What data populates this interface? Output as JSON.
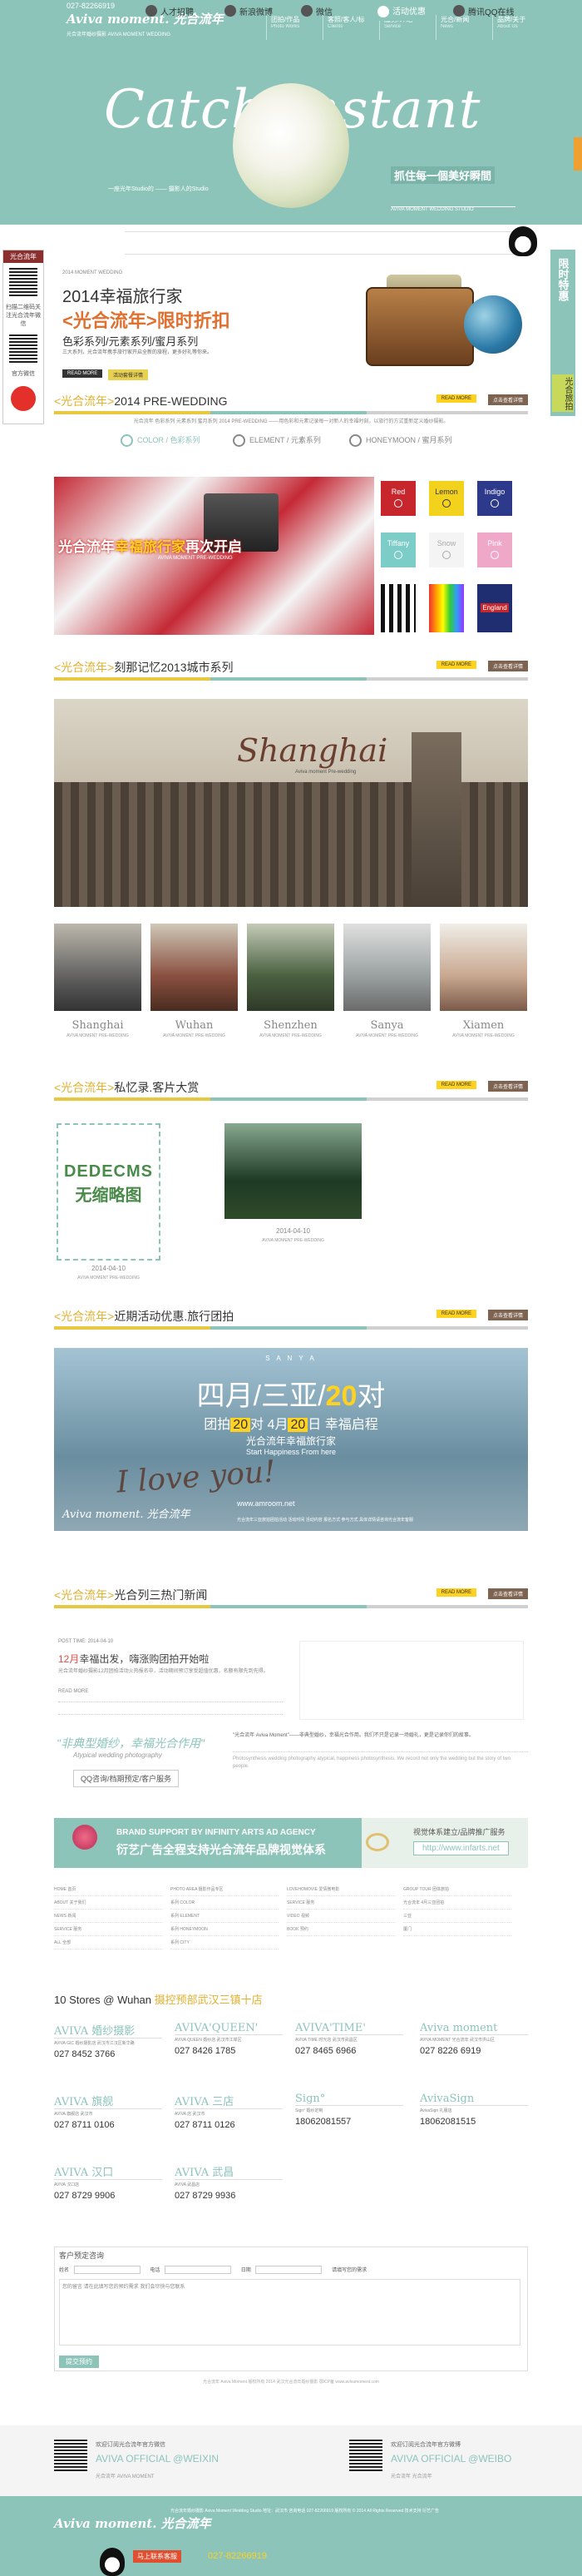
{
  "header": {
    "phone": "027-82266919",
    "logo": "Aviva moment. 光合流年",
    "tagline": "光合流年婚纱摄影 AVIVA MOMENT WEDDING",
    "nav": [
      {
        "cn": "团拍/作品",
        "en": "Photo Works"
      },
      {
        "cn": "客照/客人/标",
        "en": "Clients"
      },
      {
        "cn": "服务/介绍",
        "en": "Service"
      },
      {
        "cn": "光合/新闻",
        "en": "News"
      },
      {
        "cn": "品牌/关于",
        "en": "About Us"
      }
    ]
  },
  "hero": {
    "title": "Catch Instant",
    "sub": "抓住每一個美好瞬間",
    "small": "一座光年Studio的 —— 摄影人的Studio",
    "rline": "AVIVA MOMENT WEDDING STUDIO"
  },
  "menu": {
    "items": [
      "人才招聘",
      "新浪微博",
      "微信",
      "活动优惠",
      "腾讯QQ在线"
    ]
  },
  "left_sidebar": {
    "head": "光合流年",
    "t1": "扫描二维码关注光合流年微信",
    "t2": "官方微信"
  },
  "right_tab": {
    "label": "限时特惠",
    "sub": "光合旅拍"
  },
  "promo": {
    "date": "2014 MOMENT WEDDING",
    "h1": "2014幸福旅行家",
    "h2": "<光合流年>限时折扣",
    "h3": "色彩系列/元素系列/蜜月系列",
    "desc": "三大系列，光合流年携手旅行家开启全新的旅程，更多好礼等你来。",
    "more": "READ MORE",
    "btn": "活动套餐详情"
  },
  "sections": {
    "prewedding": {
      "a": "<光合流年>",
      "b": "2014 PRE-WEDDING"
    },
    "city": {
      "a": "<光合流年>",
      "b": "刻那记忆2013城市系列"
    },
    "guests": {
      "a": "<光合流年>",
      "b": "私忆录.客片大赏"
    },
    "offers": {
      "a": "<光合流年>",
      "b": "近期活动优惠.旅行团拍"
    },
    "news": {
      "a": "<光合流年>",
      "b": "光合列三热门新闻"
    },
    "more": "READ MORE",
    "btn": "点击查看详情"
  },
  "prewedding": {
    "desc": "光合流年 色彩系列 元素系列 蜜月系列 2014 PRE-WEDDING ——用色彩和元素记录每一对新人的幸福时刻，以旅行的方式重新定义婚纱摄影。",
    "tabs": [
      "COLOR / 色彩系列",
      "ELEMENT / 元素系列",
      "HONEYMOON / 蜜月系列"
    ],
    "banner_cap": "光合流年",
    "banner_cap2": "幸福旅行家",
    "banner_cap3": "再次开启",
    "banner_sub": "AVIVA MOMENT PRE-WEDDING",
    "swatches": [
      "Red",
      "Lemon",
      "Indigo",
      "Tiffany",
      "Snow",
      "Pink"
    ],
    "england": "England"
  },
  "city": {
    "title": "Shanghai",
    "sub": "Aviva moment Pre-wedding",
    "thumbs": [
      {
        "n": "Shanghai",
        "s": "AVIVA MOMENT PRE-WEDDING"
      },
      {
        "n": "Wuhan",
        "s": "AVIVA MOMENT PRE-WEDDING"
      },
      {
        "n": "Shenzhen",
        "s": "AVIVA MOMENT PRE-WEDDING"
      },
      {
        "n": "Sanya",
        "s": "AVIVA MOMENT PRE-WEDDING"
      },
      {
        "n": "Xiamen",
        "s": "AVIVA MOMENT PRE-WEDDING"
      }
    ]
  },
  "guests": {
    "noimg_a": "DEDECMS",
    "noimg_b": "无缩略图",
    "date1": "2014-04-10",
    "sub1": "AVIVA MOMENT PRE-WEDDING",
    "date2": "2014-04-10",
    "sub2": "AVIVA MOMENT PRE-WEDDING"
  },
  "sanya": {
    "top": "S A N Y A",
    "big_a": "四月/三亚/",
    "big_b": "20",
    "big_c": "对",
    "mid_a": "团拍",
    "mid_b": "20",
    "mid_c": "对 4月",
    "mid_d": "20",
    "mid_e": "日 幸福启程",
    "s1": "光合流年幸福旅行家",
    "s2": "Start Happiness From here",
    "love": "I love you!",
    "logo": "Aviva moment. 光合流年",
    "url": "www.amroom.net",
    "fine": "光合流年三亚旅拍团拍活动 活动时间 活动内容 报名方式 参与方式 具体详情请咨询光合流年客服"
  },
  "news": {
    "date": "POST TIME: 2014-04-10",
    "title_a": "12月",
    "title_b": "幸福出发，嗨涨购团拍开始啦",
    "body": "光合流年婚纱摄影12月团拍活动火热报名中，活动期间预订享受超值优惠，名额有限先到先得。",
    "post": "READ MORE"
  },
  "quote": {
    "title": "\"非典型婚纱，幸福光合作用\"",
    "sub": "Atypical wedding photography",
    "btn": "QQ咨询/档期预定/客户服务",
    "text": "\"光合流年 Aviva Moment\"——非典型婚纱，幸福光合作用。我们不只是记录一场婚礼，更是记录你们的故事。",
    "text2": "Photosynthesis wedding photography atypical, happiness photosynthesis. We record not only the wedding but the story of two people."
  },
  "ad": {
    "t1": "BRAND SUPPORT BY INFINITY ARTS AD AGENCY",
    "t2": "衍艺广告全程支持光合流年品牌视觉体系",
    "rt": "视觉体系建立/品牌推广服务",
    "url": "http://www.infarts.net"
  },
  "links": {
    "cols": [
      [
        "HOME 首页",
        "ABOUT 关于我们",
        "NEWS 新闻",
        "SERVICE 服务",
        "ALL 全部",
        "GALLERY 作品"
      ],
      [
        "PHOTO AREA 摄影作品专区",
        "系列 COLOR",
        "系列 ELEMENT",
        "系列 HONEYMOON",
        "系列 CITY"
      ],
      [
        "LOVEHOMOVIE 爱情微电影",
        "SERVICE 服务",
        "VIDEO 视频",
        "BOOK 预约"
      ],
      [
        "GROUP TOUR 团体旅拍",
        "光合流年 4月三亚团拍",
        "三亚",
        "厦门"
      ]
    ]
  },
  "stores": {
    "title_a": "10 Stores @ Wuhan",
    "title_b": "摄控预部武汉三镇十店",
    "list": [
      {
        "n": "AVIVA 婚纱摄影",
        "a": "AVIVA GIC 婚纱摄影店 武汉市江汉区新华路",
        "p": "027 8452 3766"
      },
      {
        "n": "AVIVA'QUEEN'",
        "a": "AVIVA QUEEN 婚纱店 武汉市江岸区",
        "p": "027 8426 1785"
      },
      {
        "n": "AVIVA'TIME'",
        "a": "AVIVA TIME 时光店 武汉市武昌区",
        "p": "027 8465 6966"
      },
      {
        "n": "Aviva moment",
        "a": "AVIVA MOMENT 光合流年 武汉市洪山区",
        "p": "027 8226 6919"
      },
      {
        "n": "AVIVA 旗舰",
        "a": "AVIVA 旗舰店 武汉市",
        "p": "027 8711 0106"
      },
      {
        "n": "Sign°",
        "a": "Sign° 婚纱定制",
        "p": "18062081557"
      },
      {
        "n": "AvivaSign",
        "a": "AvivaSign 礼服店",
        "p": "18062081515"
      },
      {
        "n": "AVIVA 三店",
        "a": "AVIVA 店 武汉市",
        "p": "027 8711 0126"
      },
      {
        "n": "AVIVA 汉口",
        "a": "AVIVA 汉口店",
        "p": "027 8729 9906"
      },
      {
        "n": "AVIVA 武昌",
        "a": "AVIVA 武昌店",
        "p": "027 8729 9936"
      }
    ]
  },
  "form": {
    "title": "客户预定咨询",
    "name": "姓名",
    "phone": "电话",
    "date": "日期",
    "note": "请填写您的需求",
    "ta": "您的留言 请在此填写您的预约需求 我们会尽快与您联系",
    "submit": "提交预约"
  },
  "fine2": "光合流年 Aviva Moment 版权所有 2014 武汉光合流年婚纱摄影 鄂ICP备 www.avivamoment.com",
  "social": {
    "l_t": "欢迎订阅光合流年官方微信",
    "l_b": "AVIVA OFFICIAL @WEIXIN",
    "l_f": "光合流年 AVIVA MOMENT",
    "r_t": "欢迎订阅光合流年官方微博",
    "r_b": "AVIVA OFFICIAL @WEIBO",
    "r_f": "光合流年 光合流年"
  },
  "footer": {
    "logo": "Aviva moment. 光合流年",
    "text": "光合流年婚纱摄影 Aviva Moment Wedding Studio 地址：武汉市 咨询电话 027-82266919 版权所有 © 2014 All Rights Reserved 技术支持 衍艺广告",
    "qq": "马上联系客服",
    "tel": "027-82266919"
  }
}
